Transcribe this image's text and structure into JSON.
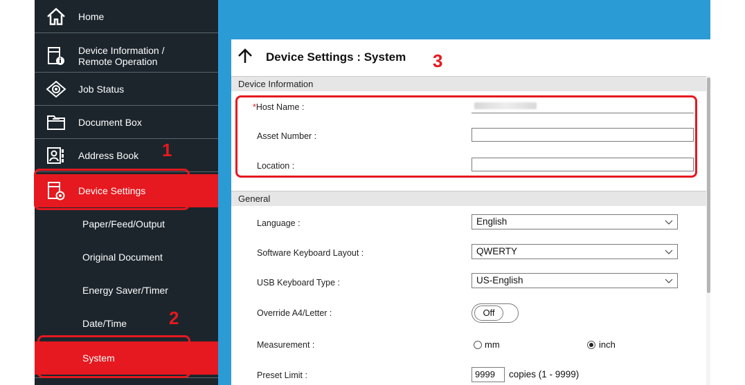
{
  "sidebar": {
    "items": [
      {
        "label": "Home",
        "icon": "home-icon"
      },
      {
        "label_line1": "Device Information /",
        "label_line2": "Remote Operation",
        "icon": "device-info-icon"
      },
      {
        "label": "Job Status",
        "icon": "eye-icon"
      },
      {
        "label": "Document Box",
        "icon": "folder-icon"
      },
      {
        "label": "Address Book",
        "icon": "address-book-icon"
      },
      {
        "label": "Device Settings",
        "icon": "device-settings-icon"
      }
    ],
    "sub_items": [
      {
        "label": "Paper/Feed/Output"
      },
      {
        "label": "Original Document"
      },
      {
        "label": "Energy Saver/Timer"
      },
      {
        "label": "Date/Time"
      },
      {
        "label": "System"
      }
    ]
  },
  "page": {
    "title": "Device Settings : System"
  },
  "sections": {
    "device_info": {
      "header": "Device Information",
      "host_name_required": "*",
      "host_name_label": "Host Name :",
      "asset_number_label": "Asset Number :",
      "location_label": "Location :"
    },
    "general": {
      "header": "General",
      "language_label": "Language :",
      "language_value": "English",
      "keyboard_layout_label": "Software Keyboard Layout :",
      "keyboard_layout_value": "QWERTY",
      "usb_keyboard_label": "USB Keyboard Type :",
      "usb_keyboard_value": "US-English",
      "override_label": "Override A4/Letter :",
      "override_value": "Off",
      "measurement_label": "Measurement :",
      "measurement_mm": "mm",
      "measurement_inch": "inch",
      "measurement_selected": "inch",
      "preset_limit_label": "Preset Limit :",
      "preset_limit_value": "9999",
      "preset_limit_suffix": "copies (1 - 9999)"
    }
  },
  "callouts": {
    "one": "1",
    "two": "2",
    "three": "3"
  },
  "colors": {
    "accent_red": "#e5191f",
    "sidebar_bg": "#1c252c",
    "header_blue": "#2b9bd6"
  }
}
